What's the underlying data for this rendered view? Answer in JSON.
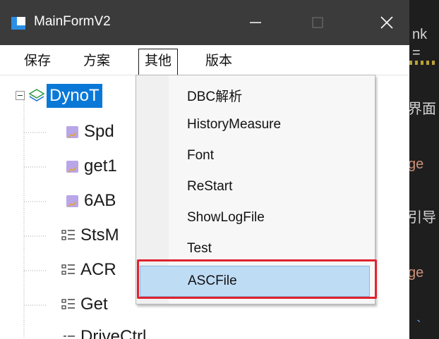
{
  "window": {
    "title": "MainFormV2",
    "controls": {
      "minimize": "minimize",
      "maximize": "maximize",
      "close": "close"
    }
  },
  "menubar": {
    "items": [
      {
        "label": "保存"
      },
      {
        "label": "方案"
      },
      {
        "label": "其他",
        "active": true
      },
      {
        "label": "版本"
      }
    ]
  },
  "tree": {
    "root": {
      "label": "DynoT",
      "icon": "layers-icon"
    },
    "children": [
      {
        "label": "Spd",
        "icon": "chart-icon"
      },
      {
        "label": "get1",
        "icon": "chart-icon"
      },
      {
        "label": "6AB",
        "icon": "chart-icon"
      },
      {
        "label": "StsM",
        "icon": "list-icon"
      },
      {
        "label": "ACR",
        "icon": "list-icon"
      },
      {
        "label": "Get",
        "icon": "list-icon"
      },
      {
        "label": "DriveCtrl",
        "icon": "list-icon"
      }
    ]
  },
  "dropdown": {
    "items": [
      {
        "label": "DBC解析"
      },
      {
        "label": "HistoryMeasure"
      },
      {
        "label": "Font"
      },
      {
        "label": "ReStart"
      },
      {
        "label": "ShowLogFile"
      },
      {
        "label": "Test"
      },
      {
        "label": "ASCFile",
        "highlighted": true
      }
    ]
  },
  "background_editor": {
    "lines": [
      "nk",
      "=",
      "界面",
      "ge",
      "引导",
      "ge",
      "`"
    ]
  },
  "colors": {
    "titlebar": "#3b3b3b",
    "selection": "#0a78d7",
    "menu_highlight": "#bfdcf5",
    "annotation_red": "#e0232f"
  }
}
